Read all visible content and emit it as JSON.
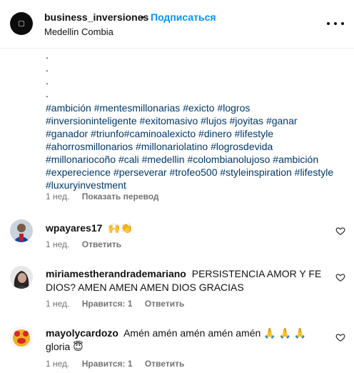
{
  "header": {
    "username": "business_inversiones",
    "separator": "•",
    "follow_label": "Подписаться",
    "location": "Medellin Combia"
  },
  "caption": {
    "dots": [
      ".",
      ".",
      ".",
      "."
    ],
    "lines": [
      "#ambición #mentesmillonarias #exicto #logros",
      "#inversioninteligente #exitomasivo #lujos #joyitas #ganar",
      "#ganador #triunfo#caminoalexicto #dinero #lifestyle",
      "#ahorrosmillonarios #millonariolatino #logrosdevida",
      "#millonariocoño #cali #medellin #colombianolujoso #ambición",
      "#experecience #perseverar #trofeo500 #styleinspiration #lifestyle",
      "#luxuryinvestment"
    ],
    "time": "1 нед.",
    "translate_label": "Показать перевод"
  },
  "comments": [
    {
      "username": "wpayares17",
      "text": "🙌👏",
      "time": "1 нед.",
      "reply_label": "Ответить"
    },
    {
      "username": "miriamestherandrademariano",
      "text": "PERSISTENCIA AMOR Y FE DIOS? AMEN AMEN AMEN DIOS GRACIAS",
      "time": "1 нед.",
      "likes_label": "Нравится: 1",
      "reply_label": "Ответить"
    },
    {
      "username": "mayolycardozo",
      "text": "Amén amén amén amén amén 🙏 🙏 🙏 gloria 😇",
      "time": "1 нед.",
      "likes_label": "Нравится: 1",
      "reply_label": "Ответить"
    }
  ],
  "icons": {
    "more": "more-horizontal-icon",
    "like": "heart-outline-icon"
  },
  "colors": {
    "link_blue": "#0095f6",
    "hashtag": "#00376b",
    "muted": "#737373"
  }
}
